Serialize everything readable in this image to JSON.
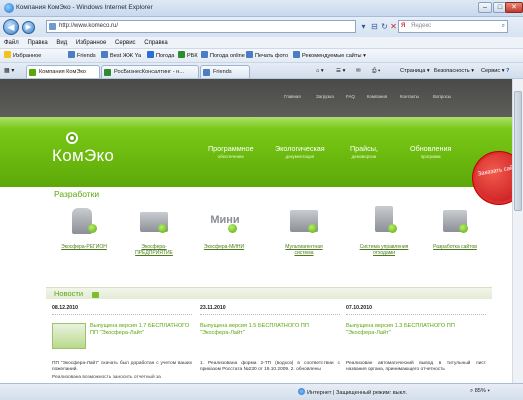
{
  "window": {
    "title": "Компания КомЭко - Windows Internet Explorer"
  },
  "address": {
    "url": "http://www.komeco.ru/",
    "search_placeholder": "Яндекс"
  },
  "menu": [
    "Файл",
    "Правка",
    "Вид",
    "Избранное",
    "Сервис",
    "Справка"
  ],
  "favorites": {
    "label": "Избранное",
    "items": [
      "Friends",
      "Best ЖЖ Ya",
      "Погода",
      "РБК",
      "Погода online",
      "Печать фото",
      "Рекомендуемые сайты ▾"
    ]
  },
  "tabs": [
    {
      "label": "Компания КомЭко"
    },
    {
      "label": "РосБизнесКонсалтинг - н..."
    },
    {
      "label": "Friends"
    }
  ],
  "toolbar": {
    "page": "Страница ▾",
    "security": "Безопасность ▾",
    "service": "Сервис ▾"
  },
  "site": {
    "top_nav": [
      "Главная",
      "Загрузка",
      "FAQ",
      "Компания",
      "Контакты",
      "Вопросы"
    ],
    "logo": "КомЭко",
    "hero_nav": [
      {
        "title": "Программное",
        "sub": "обеспечение"
      },
      {
        "title": "Экологическая",
        "sub": "документация"
      },
      {
        "title": "Прайсы,",
        "sub": "демоверсии"
      },
      {
        "title": "Обновления",
        "sub": "программ"
      }
    ],
    "order_badge": "Заказать сайт!",
    "dev_title": "Разработки",
    "products": [
      {
        "label": "Экосфера-РЕГИОН"
      },
      {
        "label": "Экосфера-ПРЕДПРИЯТИЕ"
      },
      {
        "label": "Экосфера-МИНИ",
        "pic_text": "Мини"
      },
      {
        "label": "Мультиагентная система"
      },
      {
        "label": "Система управления отходами"
      },
      {
        "label": "Разработка сайтов"
      }
    ],
    "news_title": "Новости",
    "news": [
      {
        "date": "08.12.2010",
        "headline": "Выпущена версия 1.7 БЕСПЛАТНОГО ПП \"Экосфера-Лайт\"",
        "body": "ПП \"Экосфера-Лайт\" скачать был доработан с учетом ваших пожеланий.",
        "body2": "Реализована возможность заносить отчетный за"
      },
      {
        "date": "23.11.2010",
        "headline": "Выпущена версия 1.5 БЕСПЛАТНОГО ПП \"Экосфера-Лайт\"",
        "body": "1. Реализована форма 2-ТП (водхоз) в соответствии с приказом Росстата №230 от 19.10.2009. 2. обновлены",
        "body2": ""
      },
      {
        "date": "07.10.2010",
        "headline": "Выпущена версия 1.3 БЕСПЛАТНОГО ПП \"Экосфера-Лайт\"",
        "body": "Реализован автоматический вывод в титульный лист названия органа, принимающего отчетность",
        "body2": ""
      }
    ]
  },
  "status": {
    "zone": "Интернет | Защищенный режим: выкл.",
    "zoom": "85%"
  }
}
